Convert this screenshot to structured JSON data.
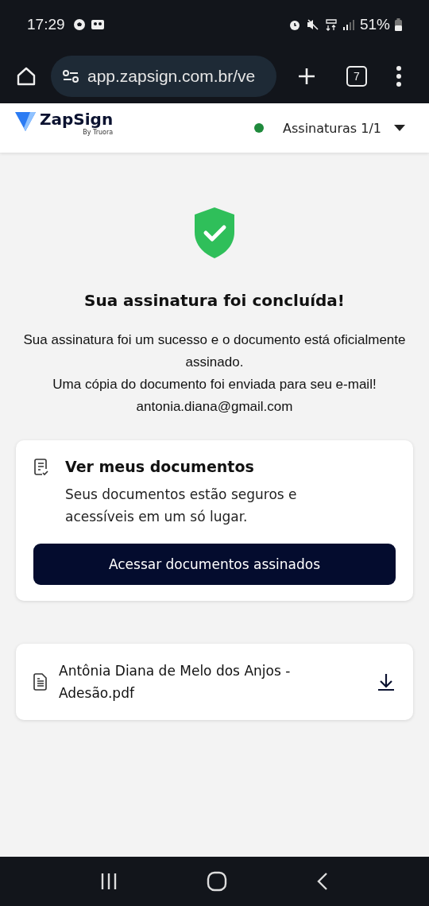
{
  "status_bar": {
    "time": "17:29",
    "battery": "51%"
  },
  "browser": {
    "url": "app.zapsign.com.br/ve",
    "tab_count": "7"
  },
  "header": {
    "brand": "ZapSign",
    "brand_sub": "By Truora",
    "signatures": "Assinaturas 1/1"
  },
  "success": {
    "title": "Sua assinatura foi concluída!",
    "messages": [
      "Sua assinatura foi um sucesso e o documento está oficialmente assinado.",
      "Uma cópia do documento foi enviada para seu e-mail! antonia.diana@gmail.com"
    ]
  },
  "documents_card": {
    "title": "Ver meus documentos",
    "text": "Seus documentos estão seguros e acessíveis em um só lugar.",
    "button": "Acessar documentos assinados"
  },
  "file": {
    "name": "Antônia Diana de Melo dos Anjos - Adesão.pdf"
  }
}
